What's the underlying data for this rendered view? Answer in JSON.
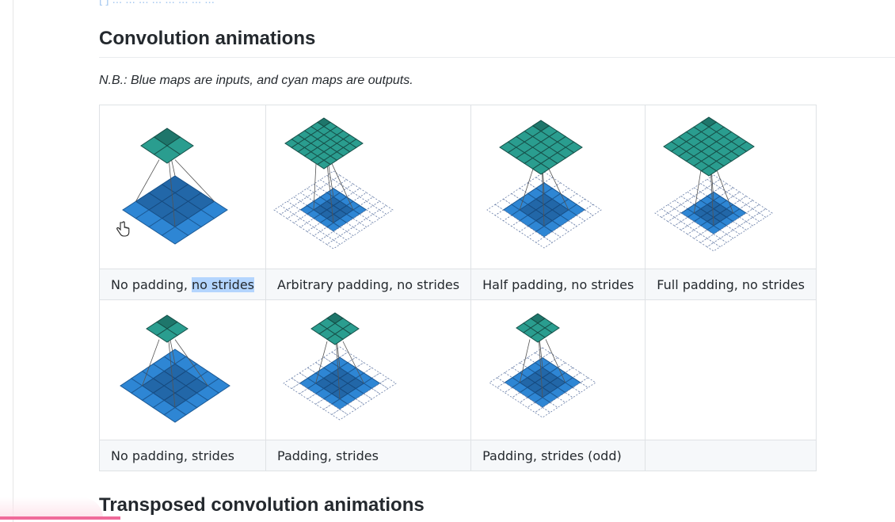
{
  "top_link_fragment": "[ ] ...  ...  ...  ...  ...  ...  ...  ...",
  "sections": {
    "convolution": {
      "title": "Convolution animations",
      "note": "N.B.: Blue maps are inputs, and cyan maps are outputs."
    },
    "transposed": {
      "title": "Transposed convolution animations"
    }
  },
  "table": {
    "row1": {
      "captions": [
        "No padding, ",
        "Arbitrary padding, no strides",
        "Half padding, no strides",
        "Full padding, no strides"
      ],
      "highlight": "no strides"
    },
    "row2": {
      "captions": [
        "No padding, strides",
        "Padding, strides",
        "Padding, strides (odd)",
        ""
      ]
    }
  },
  "colors": {
    "input_blue": "#2e86d4",
    "output_cyan": "#2a9d8f",
    "highlight": "#b4d5fe",
    "accent_pink": "#f06a9a"
  },
  "icons": {
    "cursor": "hand-pointer-icon"
  }
}
